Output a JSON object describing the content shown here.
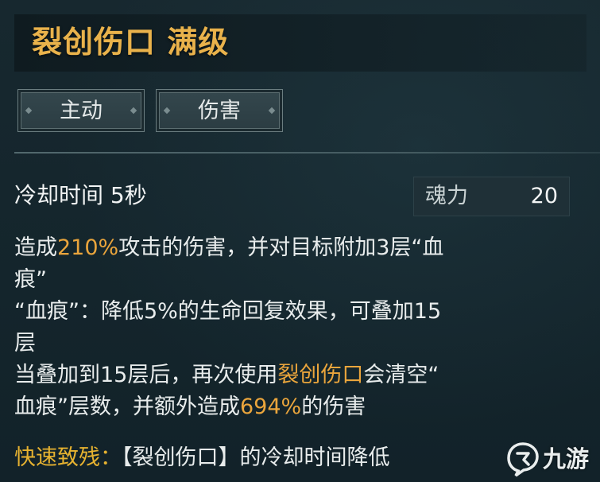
{
  "skill": {
    "title": "裂创伤口 满级",
    "tags": [
      "主动",
      "伤害"
    ],
    "cooldown": "冷却时间 5秒",
    "cost_label": "魂力",
    "cost_value": "20"
  },
  "description": {
    "line1_a": "造成",
    "line1_hl": "210%",
    "line1_b": "攻击的伤害，并对目标附加3层“血",
    "line2": "痕”",
    "line3": "“血痕”：降低5%的生命回复效果，可叠加15",
    "line4": "层",
    "line5_a": "当叠加到15层后，再次使用",
    "line5_hl": "裂创伤口",
    "line5_b": "会清空“",
    "line6_a": "血痕”层数，并额外造成",
    "line6_hl": "694%",
    "line6_b": "的伤害",
    "line7_hl": "快速致残：",
    "line7_b": "【裂创伤口】的冷却时间降低"
  },
  "watermark": {
    "text": "九游"
  },
  "colors": {
    "title": "#e9b24b",
    "highlight": "#eaa53c",
    "background": "#15262d"
  }
}
